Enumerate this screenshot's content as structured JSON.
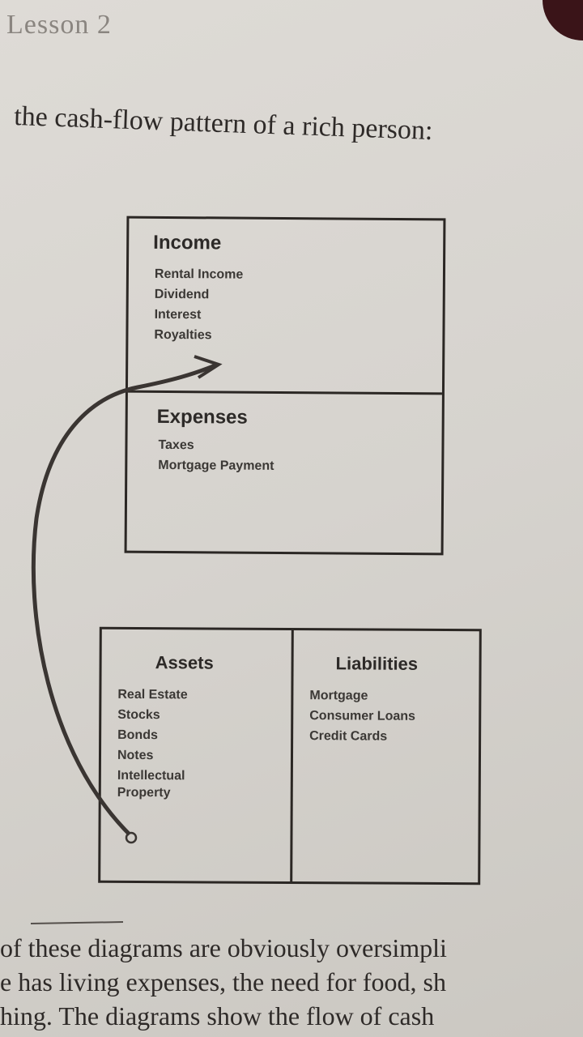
{
  "header": {
    "lesson": "Lesson 2",
    "heading": "the cash-flow pattern of a rich person:"
  },
  "income_statement": {
    "income": {
      "title": "Income",
      "items": [
        "Rental Income",
        "Dividend",
        "Interest",
        "Royalties"
      ]
    },
    "expenses": {
      "title": "Expenses",
      "items": [
        "Taxes",
        "Mortgage Payment"
      ]
    }
  },
  "balance_sheet": {
    "assets": {
      "title": "Assets",
      "items": [
        "Real Estate",
        "Stocks",
        "Bonds",
        "Notes",
        "Intellectual",
        "Property"
      ]
    },
    "liabilities": {
      "title": "Liabilities",
      "items": [
        "Mortgage",
        "Consumer Loans",
        "Credit Cards"
      ]
    }
  },
  "body_text": [
    "of these diagrams are obviously oversimpli",
    "e has living expenses, the need for food, sh",
    "hing. The diagrams show the flow of cash"
  ]
}
